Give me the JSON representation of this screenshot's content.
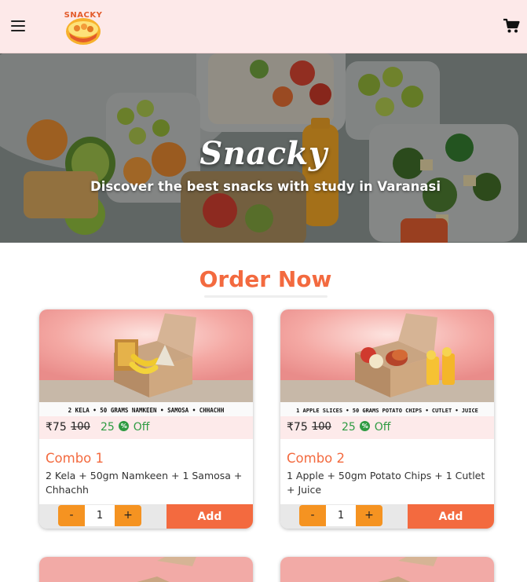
{
  "header": {
    "logo_text": "SNACKY",
    "menu_icon": "hamburger-icon",
    "cart_icon": "cart-icon"
  },
  "hero": {
    "title": "Snacky",
    "subtitle": "Discover the best snacks with study in Varanasi"
  },
  "section": {
    "title": "Order Now"
  },
  "products": [
    {
      "banner": "2 KELA • 50 GRAMS NAMKEEN • SAMOSA • CHHACHH",
      "price": "₹75",
      "mrp": "100",
      "off_value": "25",
      "off_label": "Off",
      "name": "Combo 1",
      "desc": "2 Kela + 50gm Namkeen + 1 Samosa + Chhachh",
      "qty": "1",
      "minus": "-",
      "plus": "+",
      "add": "Add"
    },
    {
      "banner": "1 APPLE SLICES • 50 GRAMS POTATO CHIPS • CUTLET • JUICE",
      "price": "₹75",
      "mrp": "100",
      "off_value": "25",
      "off_label": "Off",
      "name": "Combo 2",
      "desc": "1 Apple + 50gm Potato Chips + 1 Cutlet + Juice",
      "qty": "1",
      "minus": "-",
      "plus": "+",
      "add": "Add"
    }
  ],
  "colors": {
    "accent": "#f36a3f",
    "stepper": "#f59321",
    "discount": "#2e9b42",
    "header_bg": "#fde9e9"
  }
}
